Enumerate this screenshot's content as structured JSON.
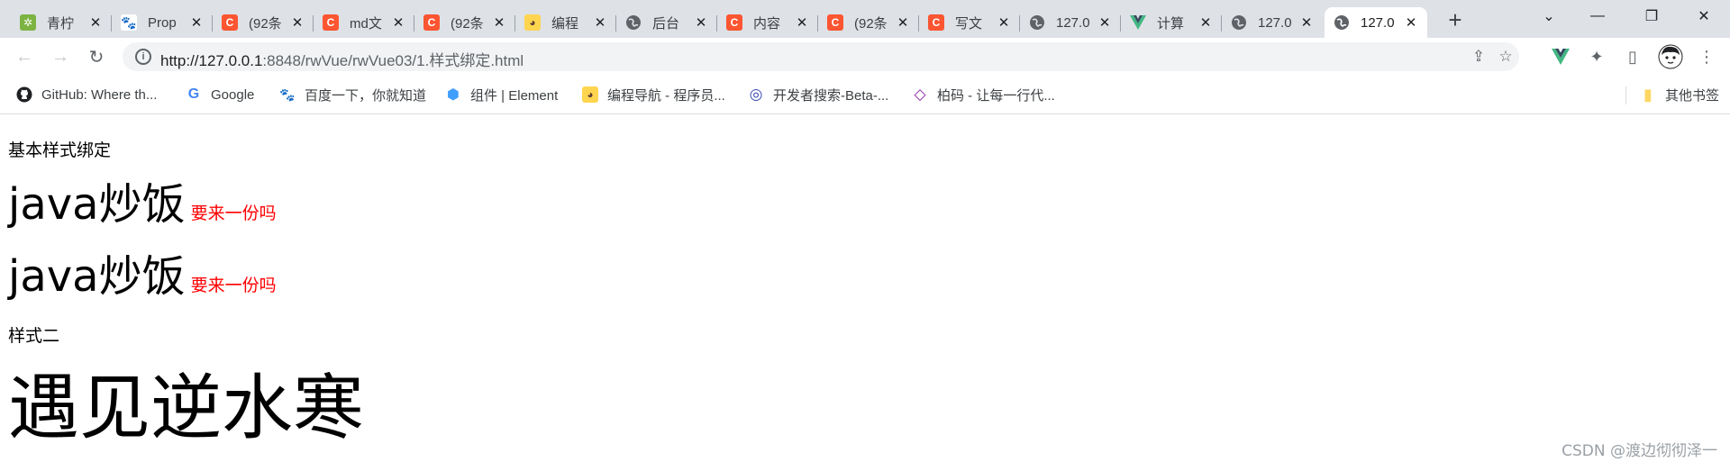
{
  "tabs": [
    {
      "title": "青柠",
      "icon": "lime-icon",
      "glyph": "✲",
      "active": false
    },
    {
      "title": "Prop",
      "icon": "baidu-paw-icon",
      "glyph": "🐾",
      "active": false
    },
    {
      "title": "(92条",
      "icon": "csdn-icon",
      "glyph": "C",
      "active": false
    },
    {
      "title": "md文",
      "icon": "csdn-icon",
      "glyph": "C",
      "active": false
    },
    {
      "title": "(92条",
      "icon": "csdn-icon",
      "glyph": "C",
      "active": false
    },
    {
      "title": "编程",
      "icon": "duck-icon",
      "glyph": "◕",
      "active": false
    },
    {
      "title": "后台",
      "icon": "globe-icon",
      "glyph": "🌐",
      "active": false
    },
    {
      "title": "内容",
      "icon": "csdn-icon",
      "glyph": "C",
      "active": false
    },
    {
      "title": "(92条",
      "icon": "csdn-icon",
      "glyph": "C",
      "active": false
    },
    {
      "title": "写文",
      "icon": "csdn-icon",
      "glyph": "C",
      "active": false
    },
    {
      "title": "127.0",
      "icon": "globe-icon",
      "glyph": "🌐",
      "active": false
    },
    {
      "title": "计算",
      "icon": "vue-icon",
      "glyph": "V",
      "active": false
    },
    {
      "title": "127.0",
      "icon": "globe-icon",
      "glyph": "🌐",
      "active": false
    },
    {
      "title": "127.0",
      "icon": "globe-icon",
      "glyph": "🌐",
      "active": true
    }
  ],
  "close_glyph": "✕",
  "new_tab_glyph": "+",
  "window_controls": {
    "tab_search": "⌄",
    "minimize": "—",
    "restore": "❐",
    "close": "✕"
  },
  "nav": {
    "back": "←",
    "forward": "→",
    "reload": "↻"
  },
  "address": {
    "info_glyph": "i",
    "url_host": "http://127.0.0.1",
    "url_rest": ":8848/rwVue/rwVue03/1.样式绑定.html"
  },
  "toolbar_icons": {
    "share": "⇪",
    "star": "☆",
    "vue_devtools": "▼",
    "extensions": "✦",
    "sidepanel": "▯",
    "menu": "⋮"
  },
  "bookmarks": [
    {
      "label": "GitHub: Where th...",
      "icon": "github-icon",
      "glyph": "●",
      "color": "#202124"
    },
    {
      "label": "Google",
      "icon": "google-icon",
      "glyph": "G",
      "color": "#4285f4"
    },
    {
      "label": "百度一下，你就知道",
      "icon": "baidu-paw-icon",
      "glyph": "🐾",
      "color": "#2932e1"
    },
    {
      "label": "组件 | Element",
      "icon": "element-icon",
      "glyph": "⬢",
      "color": "#409eff"
    },
    {
      "label": "编程导航 - 程序员...",
      "icon": "duck-icon",
      "glyph": "◕",
      "color": "#f9a825"
    },
    {
      "label": "开发者搜索-Beta-...",
      "icon": "devsearch-icon",
      "glyph": "◎",
      "color": "#3949ab"
    },
    {
      "label": "柏码 - 让每一行代...",
      "icon": "bm-diamond-icon",
      "glyph": "◇",
      "color": "#8e24aa"
    }
  ],
  "other_bookmarks": {
    "label": "其他书签",
    "icon": "folder-icon",
    "glyph": "▮"
  },
  "page": {
    "basic_title": "基本样式绑定",
    "row1_big": "java炒饭",
    "row1_small": "要来一份吗",
    "row2_big": "java炒饭",
    "row2_small": "要来一份吗",
    "style2_title": "样式二",
    "huge_text": "遇见逆水寒"
  },
  "watermark": "CSDN @渡边彻彻泽一",
  "colors": {
    "accent_red": "#ff0000",
    "csdn": "#fc5531",
    "vue": "#42b883"
  }
}
